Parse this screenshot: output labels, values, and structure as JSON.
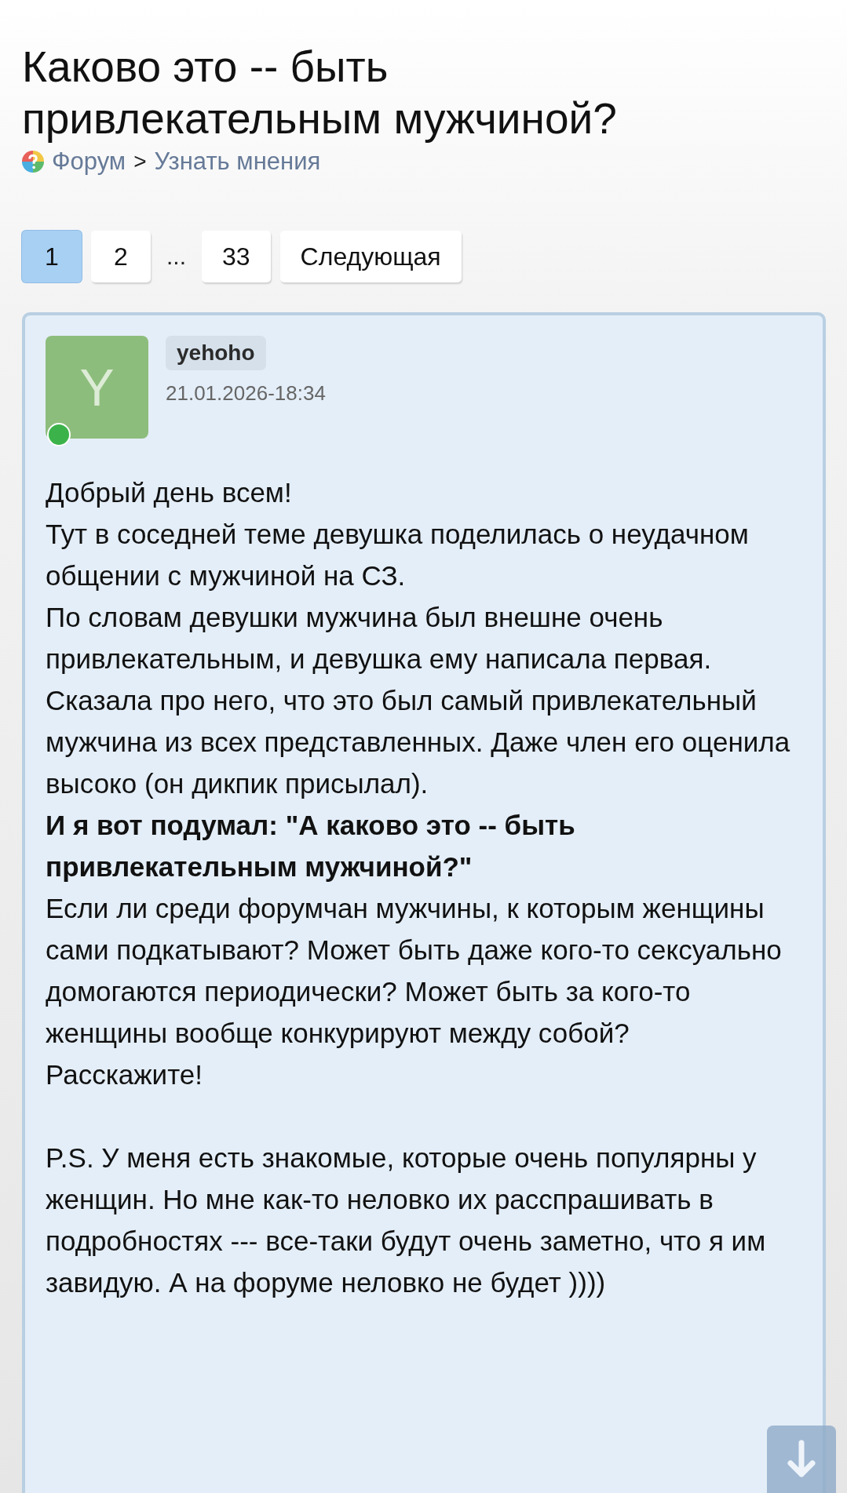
{
  "title": "Каково это -- быть привлекательным мужчиной?",
  "breadcrumb": {
    "forum": "Форум",
    "separator": ">",
    "section": "Узнать мнения"
  },
  "pagination": [
    {
      "label": "1",
      "kind": "page",
      "selected": true
    },
    {
      "label": "2",
      "kind": "page",
      "selected": false
    },
    {
      "label": "...",
      "kind": "ellipsis"
    },
    {
      "label": "33",
      "kind": "page",
      "selected": false
    },
    {
      "label": "Следующая",
      "kind": "page",
      "selected": false
    }
  ],
  "post": {
    "avatar_letter": "Y",
    "online": true,
    "author": "yehoho",
    "date": "21.01.2026-18:34",
    "body": [
      [
        {
          "kind": "text",
          "text": "Добрый день всем!"
        },
        {
          "kind": "text",
          "text": "Тут в соседней теме девушка поделилась о неудачном общении с мужчиной на СЗ."
        },
        {
          "kind": "text",
          "text": "По словам девушки мужчина был внешне очень привлекательным, и девушка ему написала первая. Сказала про него, что это был самый привлекательный мужчина из всех представленных. Даже член его оценила высоко (он дикпик присылал)."
        },
        {
          "kind": "bold",
          "text": "И я вот подумал: \"А каково это -- быть привлекательным мужчиной?\""
        },
        {
          "kind": "text",
          "text": "Если ли среди форумчан мужчины, к которым женщины сами подкатывают? Может быть даже кого-то сексуально домогаются периодически? Может быть за кого-то женщины вообще конкурируют между собой?"
        },
        {
          "kind": "text",
          "text": "Расскажите!"
        }
      ],
      [
        {
          "kind": "text",
          "text": "P.S. У меня есть знакомые, которые очень популярны у женщин. Но мне как-то неловко их расспрашивать в подробностях --- все-таки будут очень заметно, что я им завидую. А на форуме неловко не будет ))))"
        }
      ]
    ]
  }
}
